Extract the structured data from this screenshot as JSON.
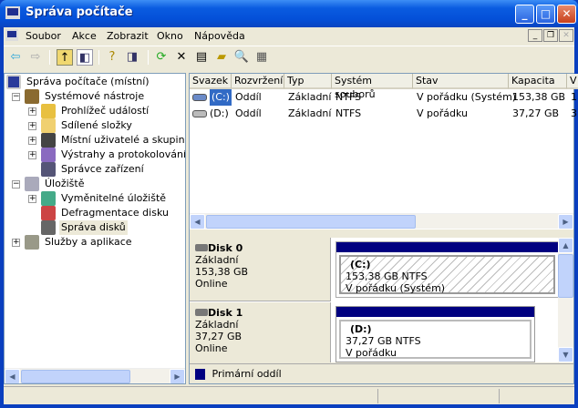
{
  "window": {
    "title": "Správa počítače",
    "buttons": [
      "minimize",
      "maximize",
      "close"
    ]
  },
  "menu": [
    "Soubor",
    "Akce",
    "Zobrazit",
    "Okno",
    "Nápověda"
  ],
  "toolbar": [
    "back-icon",
    "forward-icon",
    "up-folder-icon",
    "show-hide-tree-icon",
    "help-icon",
    "action-pane-icon",
    "refresh-icon",
    "delete-icon",
    "properties-icon",
    "open-icon",
    "search-icon",
    "settings-icon"
  ],
  "tree": {
    "root": "Správa počítače (místní)",
    "items": [
      {
        "label": "Systémové nástroje",
        "level": 1,
        "expander": "-"
      },
      {
        "label": "Prohlížeč událostí",
        "level": 2,
        "expander": "+"
      },
      {
        "label": "Sdílené složky",
        "level": 2,
        "expander": "+"
      },
      {
        "label": "Místní uživatelé a skupiny",
        "level": 2,
        "expander": "+"
      },
      {
        "label": "Výstrahy a protokolování vý",
        "level": 2,
        "expander": "+"
      },
      {
        "label": "Správce zařízení",
        "level": 2,
        "expander": ""
      },
      {
        "label": "Úložiště",
        "level": 1,
        "expander": "-"
      },
      {
        "label": "Vyměnitelné úložiště",
        "level": 2,
        "expander": "+"
      },
      {
        "label": "Defragmentace disku",
        "level": 2,
        "expander": ""
      },
      {
        "label": "Správa disků",
        "level": 2,
        "expander": "",
        "selected": true
      },
      {
        "label": "Služby a aplikace",
        "level": 1,
        "expander": "+"
      }
    ]
  },
  "volumes": {
    "columns": [
      "Svazek",
      "Rozvržení",
      "Typ",
      "Systém souborů",
      "Stav",
      "Kapacita",
      "V"
    ],
    "rows": [
      [
        "(C:)",
        "Oddíl",
        "Základní",
        "NTFS",
        "V pořádku (Systém)",
        "153,38 GB",
        "1"
      ],
      [
        "(D:)",
        "Oddíl",
        "Základní",
        "NTFS",
        "V pořádku",
        "37,27 GB",
        "3"
      ]
    ]
  },
  "disks": [
    {
      "name": "Disk 0",
      "type": "Základní",
      "size": "153,38 GB",
      "status": "Online",
      "partition": {
        "letter": "(C:)",
        "info": "153,38 GB NTFS",
        "state": "V pořádku (Systém)"
      }
    },
    {
      "name": "Disk 1",
      "type": "Základní",
      "size": "37,27 GB",
      "status": "Online",
      "partition": {
        "letter": "(D:)",
        "info": "37,27 GB NTFS",
        "state": "V pořádku"
      }
    }
  ],
  "legend": {
    "label": "Primární oddíl",
    "color": "#000080"
  }
}
